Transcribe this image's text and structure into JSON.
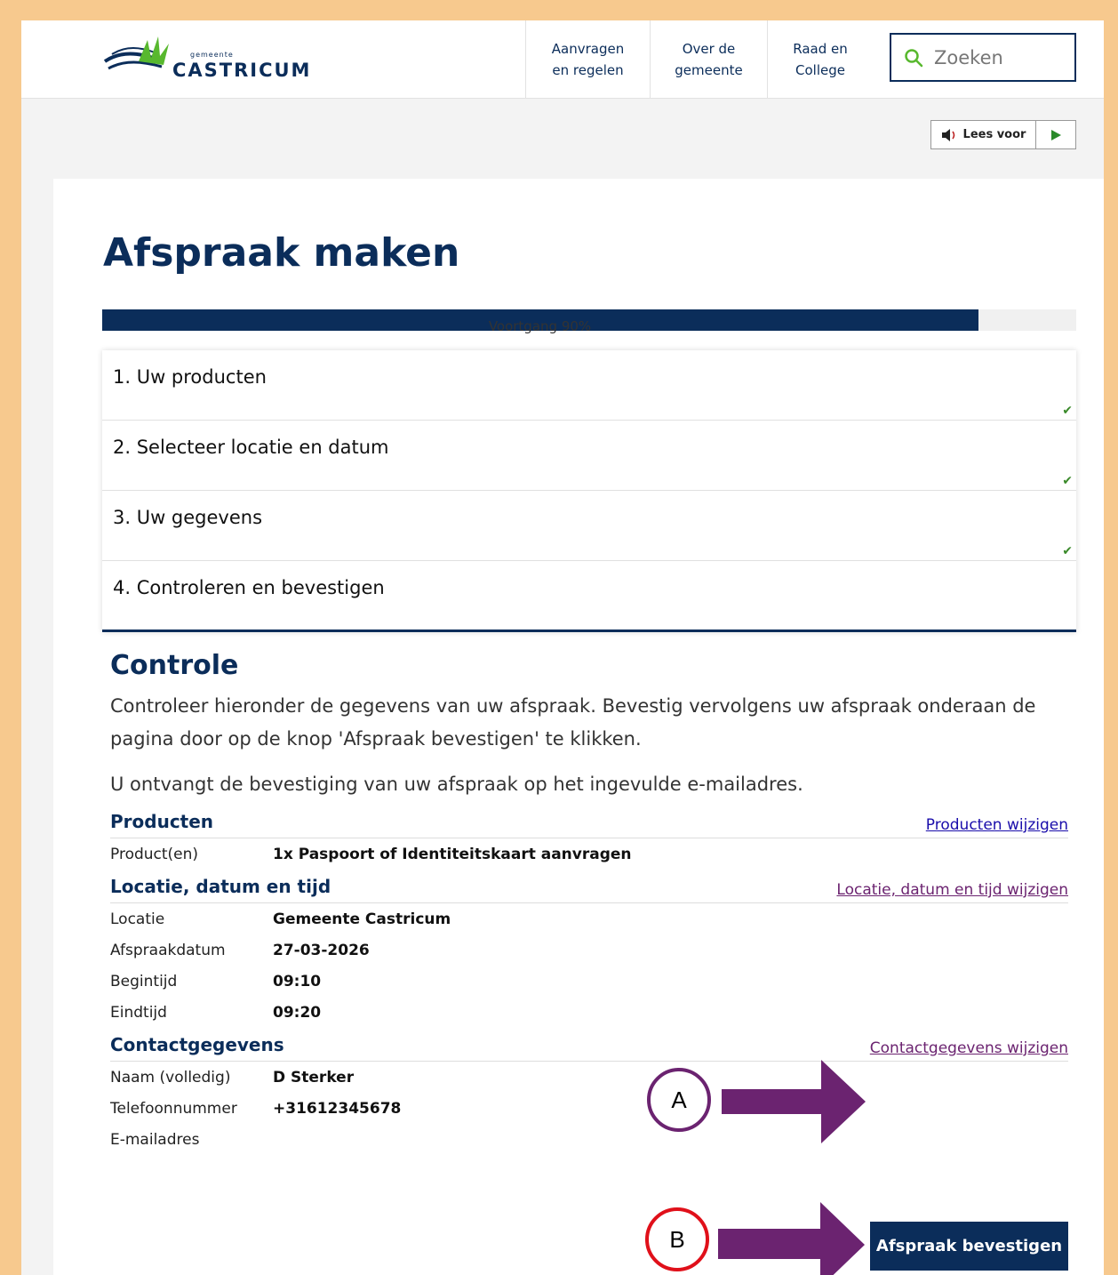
{
  "header": {
    "logo_small": "gemeente",
    "logo_text": "CASTRICUM",
    "nav": [
      {
        "line1": "Aanvragen",
        "line2": "en regelen"
      },
      {
        "line1": "Over de",
        "line2": "gemeente"
      },
      {
        "line1": "Raad en",
        "line2": "College"
      }
    ],
    "search_placeholder": "Zoeken"
  },
  "readspeaker": {
    "label": "Lees voor"
  },
  "page": {
    "title": "Afspraak maken",
    "progress_label": "Voortgang 90%",
    "progress_value": 0.9
  },
  "steps": [
    {
      "label": "1. Uw producten",
      "done": true
    },
    {
      "label": "2. Selecteer locatie en datum",
      "done": true
    },
    {
      "label": "3. Uw gegevens",
      "done": true
    },
    {
      "label": "4. Controleren en bevestigen",
      "done": false
    }
  ],
  "controle": {
    "heading": "Controle",
    "intro1": "Controleer hieronder de gegevens van uw afspraak. Bevestig vervolgens uw afspraak onderaan de pagina door op de knop 'Afspraak bevestigen' te klikken.",
    "intro2": "U ontvangt de bevestiging van uw afspraak op het ingevulde e-mailadres."
  },
  "producten": {
    "title": "Producten",
    "edit_link": "Producten wijzigen",
    "rows": [
      {
        "k": "Product(en)",
        "v": "1x Paspoort of Identiteitskaart aanvragen"
      }
    ]
  },
  "locatie": {
    "title": "Locatie, datum en tijd",
    "edit_link": "Locatie, datum en tijd wijzigen",
    "rows": [
      {
        "k": "Locatie",
        "v": "Gemeente Castricum"
      },
      {
        "k": "Afspraakdatum",
        "v": "27-03-2026"
      },
      {
        "k": "Begintijd",
        "v": "09:10"
      },
      {
        "k": "Eindtijd",
        "v": "09:20"
      }
    ]
  },
  "contact": {
    "title": "Contactgegevens",
    "edit_link": "Contactgegevens wijzigen",
    "rows": [
      {
        "k": "Naam (volledig)",
        "v": "D Sterker"
      },
      {
        "k": "Telefoonnummer",
        "v": "+31612345678"
      },
      {
        "k": "E-mailadres",
        "v": ""
      }
    ]
  },
  "confirm_button": "Afspraak bevestigen",
  "annotations": {
    "a": "A",
    "b": "B"
  },
  "colors": {
    "brand_navy": "#0b2d5a",
    "annotation_purple": "#6b2370",
    "annotation_red": "#e0101a",
    "frame_orange": "#f7c98e",
    "check_green": "#3a8a2a",
    "link_blue": "#1a0dab",
    "link_visited": "#6b2370"
  }
}
